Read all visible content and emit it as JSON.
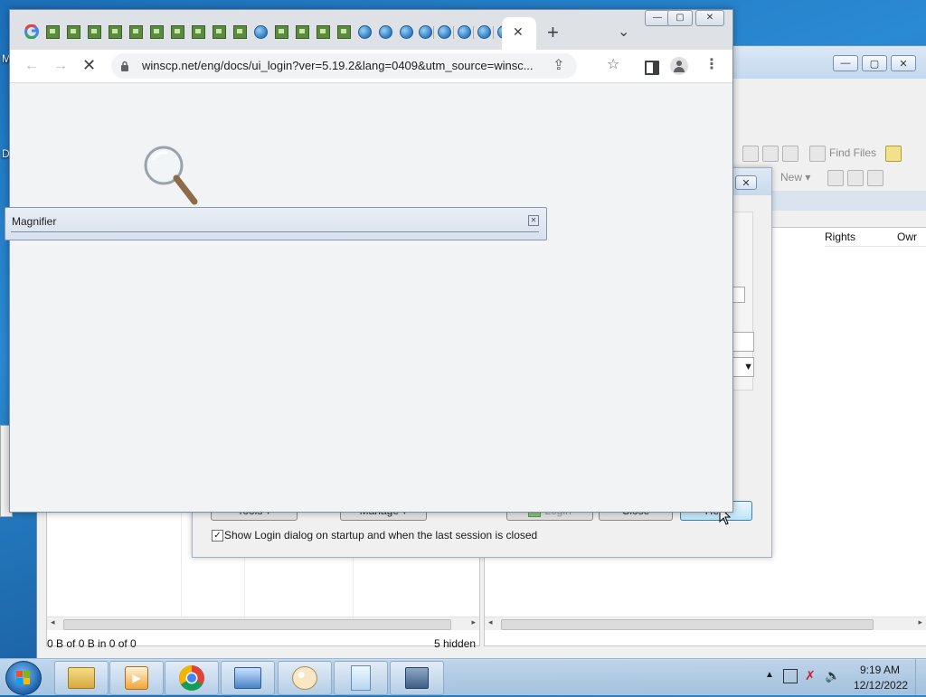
{
  "desktop": {
    "left_letter_1": "M",
    "left_letter_2": "D"
  },
  "winscp": {
    "toolbar": {
      "find_files": "Find Files",
      "new": "New"
    },
    "right_columns": [
      "Rights",
      "Owr"
    ],
    "status_left": "0 B of 0 B in 0 of 0",
    "status_right": "5 hidden"
  },
  "login_dialog": {
    "tools_button": "Tools",
    "manage_button": "Manage",
    "login_button": "Login",
    "close_button": "Close",
    "help_button": "Help",
    "checkbox_label": "Show Login dialog on startup and when the last session is closed",
    "checkbox_checked": true
  },
  "chrome": {
    "url": "winscp.net/eng/docs/ui_login?ver=5.19.2&lang=0409&utm_source=winsc...",
    "new_tab_label": "+",
    "tab_close": "✕",
    "tabs_menu": "⌄"
  },
  "magnifier": {
    "title": "Magnifier"
  },
  "taskbar": {
    "time": "9:19 AM",
    "date": "12/12/2022",
    "apps": [
      "start-button",
      "file-explorer",
      "media-player",
      "chrome",
      "control-panel",
      "paint",
      "notepad-doc",
      "network-app"
    ]
  },
  "colors": {
    "chrome_tabstrip": "#dee1e6",
    "taskbar": "#c8dcf0",
    "desktop": "#2a8ad3"
  }
}
